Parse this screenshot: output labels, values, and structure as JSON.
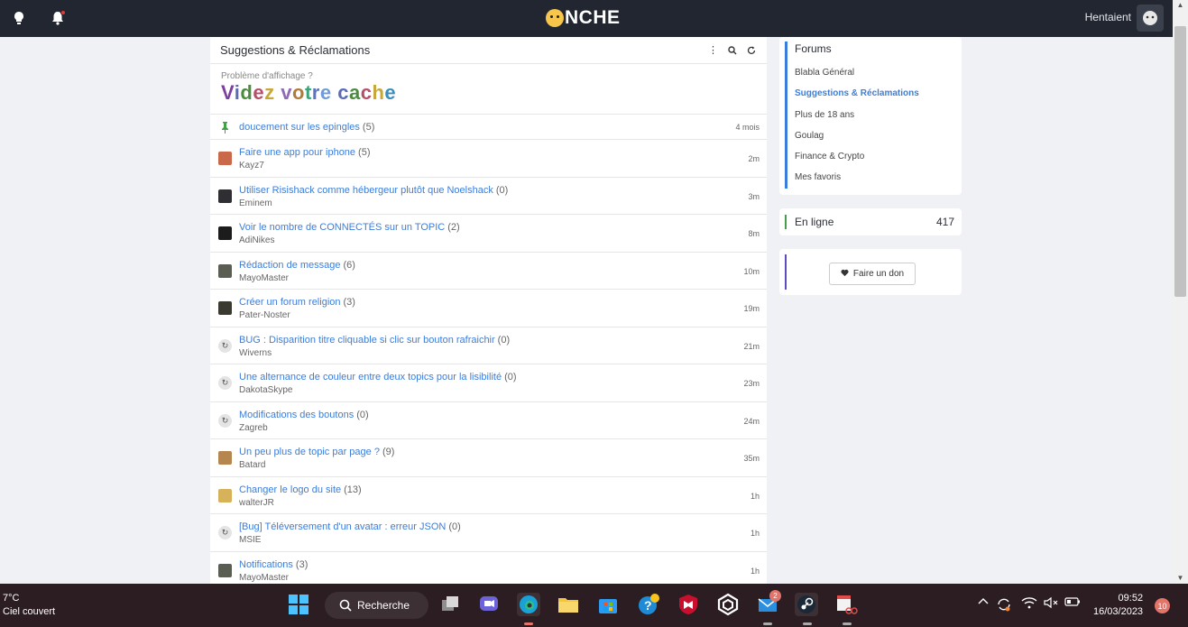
{
  "topbar": {
    "logo_text": "NCHE",
    "username": "Hentaient"
  },
  "main": {
    "title": "Suggestions & Réclamations",
    "cache_small": "Problème d'affichage ?",
    "cache_big_letters": [
      "V",
      "i",
      "d",
      "e",
      "z",
      " ",
      "v",
      "o",
      "t",
      "r",
      "e",
      " ",
      "c",
      "a",
      "c",
      "h",
      "e"
    ],
    "pinned": {
      "title": "doucement sur les epingles",
      "count": "(5)",
      "time": "4 mois"
    },
    "topics": [
      {
        "title": "Faire une app pour iphone",
        "count": "(5)",
        "author": "Kayz7",
        "time": "2m",
        "avatar": "#c9694a"
      },
      {
        "title": "Utiliser Risishack comme hébergeur plutôt que Noelshack",
        "count": "(0)",
        "author": "Eminem",
        "time": "3m",
        "avatar": "#2e2e33"
      },
      {
        "title": "Voir le nombre de CONNECTÉS sur un TOPIC",
        "count": "(2)",
        "author": "AdiNikes",
        "time": "8m",
        "avatar": "#1c1c1c"
      },
      {
        "title": "Rédaction de message",
        "count": "(6)",
        "author": "MayoMaster",
        "time": "10m",
        "avatar": "#5a5e52"
      },
      {
        "title": "Créer un forum religion",
        "count": "(3)",
        "author": "Pater-Noster",
        "time": "19m",
        "avatar": "#3a3a30"
      },
      {
        "title": "BUG : Disparition titre cliquable si clic sur bouton rafraichir",
        "count": "(0)",
        "author": "Wiverns",
        "time": "21m",
        "avatar": "refresh"
      },
      {
        "title": "Une alternance de couleur entre deux topics pour la lisibilité",
        "count": "(0)",
        "author": "DakotaSkype",
        "time": "23m",
        "avatar": "refresh"
      },
      {
        "title": "Modifications des boutons",
        "count": "(0)",
        "author": "Zagreb",
        "time": "24m",
        "avatar": "refresh"
      },
      {
        "title": "Un peu plus de topic par page ?",
        "count": "(9)",
        "author": "Batard",
        "time": "35m",
        "avatar": "#b5864e"
      },
      {
        "title": "Changer le logo du site",
        "count": "(13)",
        "author": "walterJR",
        "time": "1h",
        "avatar": "#d8b25a"
      },
      {
        "title": "[Bug] Téléversement d'un avatar : erreur JSON",
        "count": "(0)",
        "author": "MSIE",
        "time": "1h",
        "avatar": "refresh"
      },
      {
        "title": "Notifications",
        "count": "(3)",
        "author": "MayoMaster",
        "time": "1h",
        "avatar": "#5a5e52"
      }
    ]
  },
  "sidebar": {
    "forums_title": "Forums",
    "forums": [
      {
        "label": "Blabla Général",
        "active": false
      },
      {
        "label": "Suggestions & Réclamations",
        "active": true
      },
      {
        "label": "Plus de 18 ans",
        "active": false
      },
      {
        "label": "Goulag",
        "active": false
      },
      {
        "label": "Finance & Crypto",
        "active": false
      },
      {
        "label": "Mes favoris",
        "active": false
      }
    ],
    "online_label": "En ligne",
    "online_count": "417",
    "donate_label": "Faire un don"
  },
  "taskbar": {
    "temp": "7°C",
    "weather": "Ciel couvert",
    "search_label": "Recherche",
    "mail_badge": "2",
    "time": "09:52",
    "date": "16/03/2023",
    "notif_count": "10"
  }
}
